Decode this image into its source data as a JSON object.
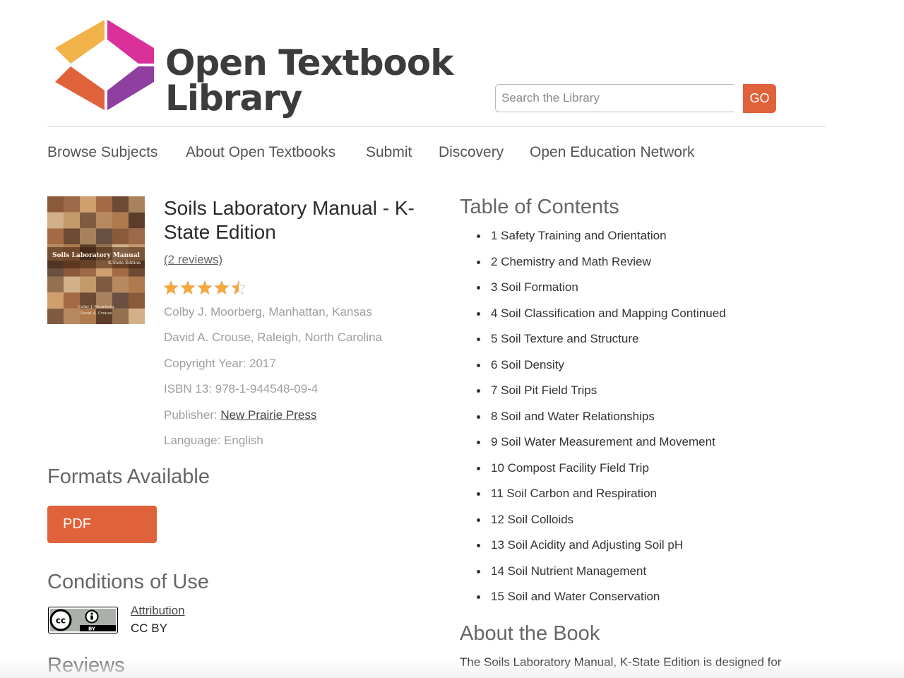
{
  "header": {
    "brand_line1": "Open Textbook",
    "brand_line2": "Library",
    "search": {
      "placeholder": "Search the Library",
      "value": ""
    },
    "go_label": "GO"
  },
  "nav": {
    "items": [
      {
        "label": "Browse Subjects"
      },
      {
        "label": "About Open Textbooks"
      },
      {
        "label": "Submit"
      },
      {
        "label": "Discovery"
      },
      {
        "label": "Open Education Network"
      }
    ]
  },
  "book": {
    "cover_title": "Soils Laboratory Manual",
    "cover_subtitle": "K-State Edition",
    "cover_authors": [
      "Colby J. Moorberg",
      "David A. Crouse"
    ],
    "title": "Soils Laboratory Manual - K-State Edition",
    "reviews_label": "(2 reviews)",
    "rating": 4.5,
    "rating_max": 5,
    "authors": [
      "Colby J. Moorberg, Manhattan, Kansas",
      "David A. Crouse, Raleigh, North Carolina"
    ],
    "copyright": "Copyright Year: 2017",
    "isbn": "ISBN 13: 978-1-944548-09-4",
    "publisher_label": "Publisher: ",
    "publisher": "New Prairie Press",
    "language": "Language: English"
  },
  "formats": {
    "heading": "Formats Available",
    "pdf_label": "PDF"
  },
  "conditions": {
    "heading": "Conditions of Use",
    "license_link": "Attribution",
    "license_code": "CC BY",
    "badge_cc": "cc",
    "badge_by": "BY"
  },
  "reviews_heading": "Reviews",
  "toc": {
    "heading": "Table of Contents",
    "items": [
      "1 Safety Training and Orientation",
      "2 Chemistry and Math Review",
      "3 Soil Formation",
      "4 Soil Classification and Mapping Continued",
      "5 Soil Texture and Structure",
      "6 Soil Density",
      "7 Soil Pit Field Trips",
      "8 Soil and Water Relationships",
      "9 Soil Water Measurement and Movement",
      "10 Compost Facility Field Trip",
      "11 Soil Carbon and Respiration",
      "12 Soil Colloids",
      "13 Soil Acidity and Adjusting Soil pH",
      "14 Soil Nutrient Management",
      "15 Soil and Water Conservation"
    ]
  },
  "about": {
    "heading": "About the Book",
    "text": "The Soils Laboratory Manual, K-State Edition is designed for"
  },
  "colors": {
    "accent": "#e0623a",
    "logo_yellow": "#f2b24a",
    "logo_orange": "#e0623a",
    "logo_magenta": "#d9309a",
    "logo_purple": "#8e3fa0",
    "star": "#f4a93a"
  }
}
